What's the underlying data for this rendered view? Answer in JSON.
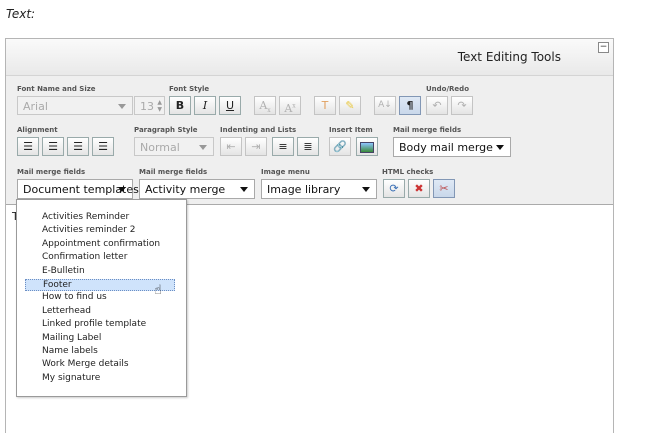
{
  "page_label": "Text:",
  "panel": {
    "title": "Text Editing Tools",
    "collapse_glyph": "−"
  },
  "labels": {
    "font": "Font Name and Size",
    "style": "Font Style",
    "undo": "Undo/Redo",
    "align": "Alignment",
    "para": "Paragraph Style",
    "indent": "Indenting and Lists",
    "insert": "Insert Item",
    "mm1": "Mail merge fields",
    "mm2": "Mail merge fields",
    "mm3": "Mail merge fields",
    "image": "Image menu",
    "html": "HTML checks"
  },
  "controls": {
    "font_name": "Arial",
    "font_size": "13",
    "para_style": "Normal",
    "body_merge": "Body mail merge",
    "doc_templates": "Document templates",
    "activity_merge": "Activity merge",
    "image_library": "Image library"
  },
  "buttons": {
    "bold": "B",
    "italic": "I",
    "underline": "U",
    "sub": "Ax",
    "sup": "Ax",
    "para_mark": "¶"
  },
  "editor_text": "T",
  "dropdown": {
    "items": [
      "Activities Reminder",
      "Activities reminder 2",
      "Appointment confirmation",
      "Confirmation letter",
      "E-Bulletin",
      "Footer",
      "How to find us",
      "Letterhead",
      "Linked profile template",
      "Mailing Label",
      "Name labels",
      "Work Merge details",
      "My signature"
    ],
    "selected": "Footer"
  },
  "colors": {
    "accent": "#cfe3fb",
    "toolbar_bg": "#efefef"
  }
}
